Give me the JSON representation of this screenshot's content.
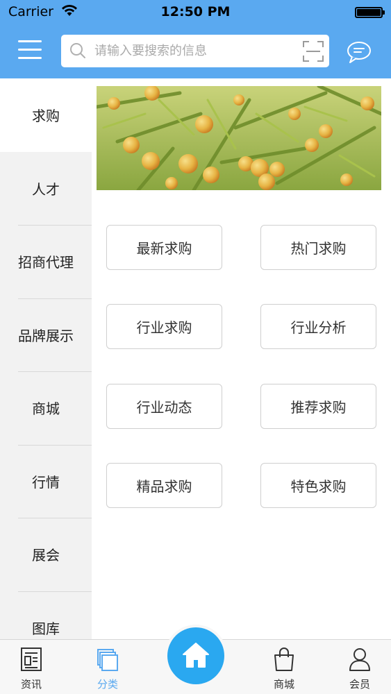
{
  "status_bar": {
    "carrier": "Carrier",
    "time": "12:50 PM"
  },
  "header": {
    "search_placeholder": "请输入要搜索的信息",
    "menu_icon": "menu-icon",
    "scan_icon": "scan-icon",
    "chat_icon": "chat-icon"
  },
  "sidebar": {
    "items": [
      {
        "label": "求购",
        "active": true
      },
      {
        "label": "人才"
      },
      {
        "label": "招商代理"
      },
      {
        "label": "品牌展示"
      },
      {
        "label": "商城"
      },
      {
        "label": "行情"
      },
      {
        "label": "展会"
      },
      {
        "label": "图库"
      }
    ]
  },
  "main": {
    "grid": [
      {
        "label": "最新求购"
      },
      {
        "label": "热门求购"
      },
      {
        "label": "行业求购"
      },
      {
        "label": "行业分析"
      },
      {
        "label": "行业动态"
      },
      {
        "label": "推荐求购"
      },
      {
        "label": "精品求购"
      },
      {
        "label": "特色求购"
      }
    ]
  },
  "tabbar": {
    "tabs": [
      {
        "label": "资讯",
        "icon": "news-icon"
      },
      {
        "label": "分类",
        "icon": "category-icon",
        "active": true
      },
      {
        "label": "商城",
        "icon": "shopping-bag-icon"
      },
      {
        "label": "会员",
        "icon": "user-icon"
      }
    ],
    "home_icon": "home-icon"
  },
  "colors": {
    "accent": "#5aa9f0",
    "home_button": "#2aa8f0"
  }
}
